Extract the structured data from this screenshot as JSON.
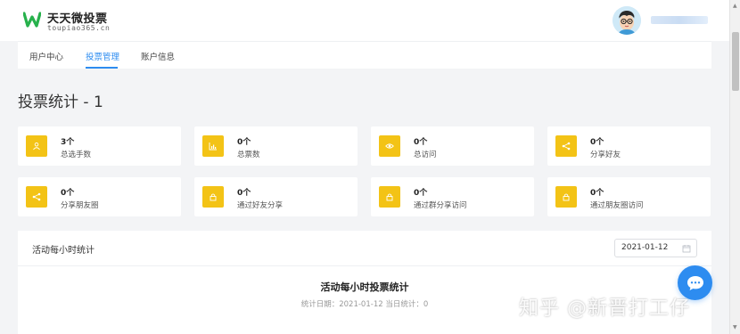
{
  "brand": {
    "title": "天天微投票",
    "subtitle": "toupiao365.cn",
    "accent_color": "#27b14c"
  },
  "header": {
    "avatar_icon": "cartoon-boy-avatar"
  },
  "nav": {
    "items": [
      {
        "label": "用户中心",
        "active": false
      },
      {
        "label": "投票管理",
        "active": true
      },
      {
        "label": "账户信息",
        "active": false
      }
    ],
    "active_color": "#2d8cf0"
  },
  "page": {
    "title": "投票统计 - 1"
  },
  "stats": [
    {
      "value": "3个",
      "label": "总选手数",
      "icon": "user-icon"
    },
    {
      "value": "0个",
      "label": "总票数",
      "icon": "bar-chart-icon"
    },
    {
      "value": "0个",
      "label": "总访问",
      "icon": "eye-icon"
    },
    {
      "value": "0个",
      "label": "分享好友",
      "icon": "share-icon"
    },
    {
      "value": "0个",
      "label": "分享朋友圈",
      "icon": "share-icon"
    },
    {
      "value": "0个",
      "label": "通过好友分享",
      "icon": "lock-icon"
    },
    {
      "value": "0个",
      "label": "通过群分享访问",
      "icon": "lock-icon"
    },
    {
      "value": "0个",
      "label": "通过朋友圈访问",
      "icon": "lock-icon"
    }
  ],
  "stat_icon_color": "#f3c316",
  "hourly_panel": {
    "title": "活动每小时统计",
    "date": "2021-01-12",
    "chart_title": "活动每小时投票统计",
    "chart_subtitle": "统计日期：2021-01-12 当日统计：0"
  },
  "watermark": {
    "text": "知乎 @新晋打工仔"
  }
}
